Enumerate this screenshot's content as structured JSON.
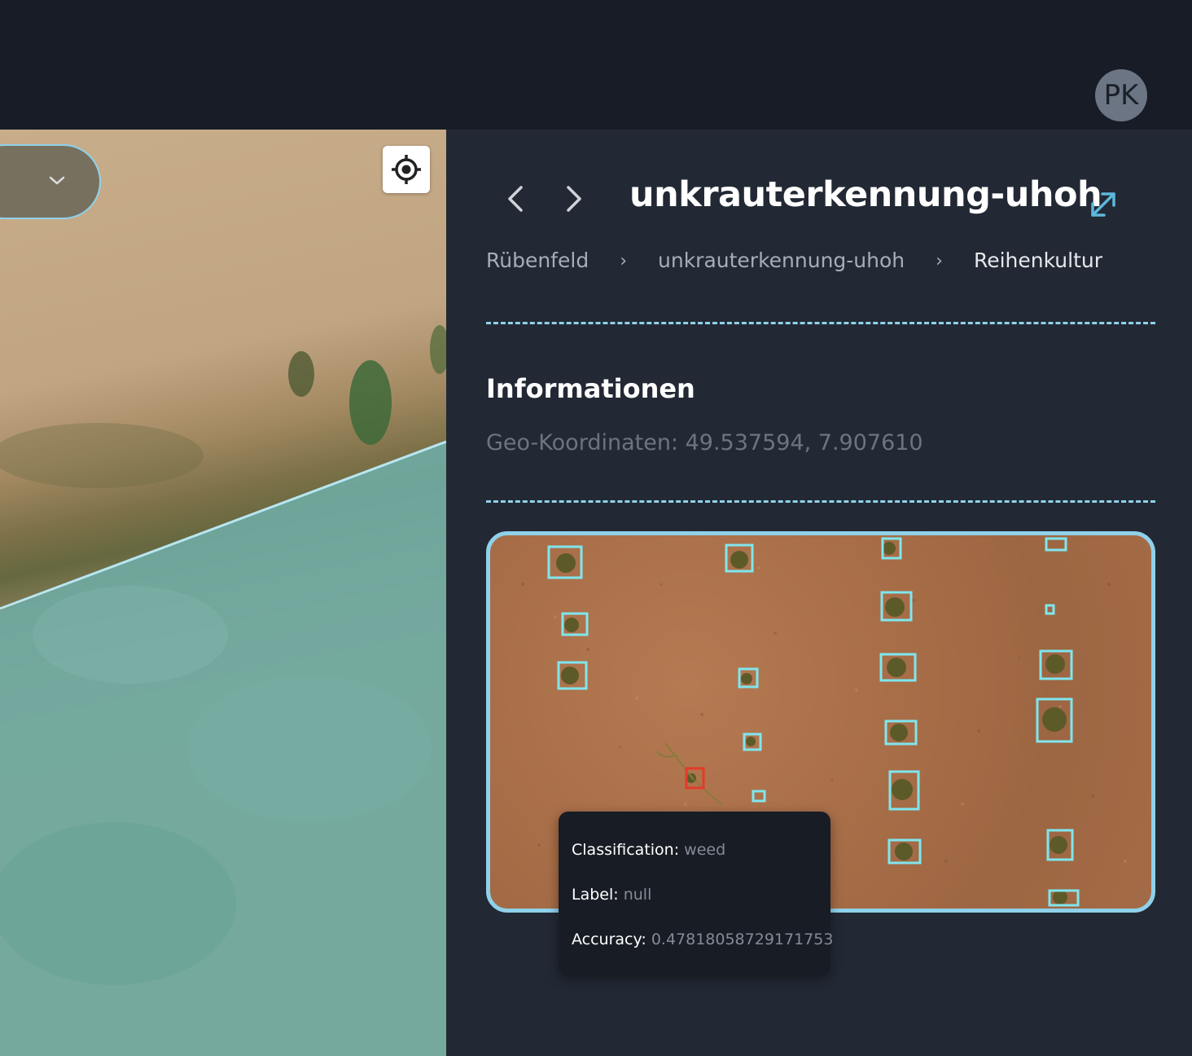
{
  "header": {
    "avatar_initials": "PK"
  },
  "map": {
    "dropdown_icon": "chevron-down-icon",
    "locate_icon": "crosshair-icon",
    "field_overlay_color": "#6fa9a0",
    "field_border_color": "#b8e6f2"
  },
  "panel": {
    "title": "unkrauterkennung-uhoh",
    "breadcrumb": [
      "Rübenfeld",
      "unkrauterkennung-uhoh",
      "Reihenkultur"
    ],
    "breadcrumb_separator": "›",
    "section_title": "Informationen",
    "geo_label": "Geo-Koordinaten: 49.537594, 7.907610",
    "accent_color": "#8fd1ea"
  },
  "detection_image": {
    "box_color_crop": "#7fe6ee",
    "box_color_weed": "#e23b2a"
  },
  "tooltip": {
    "classification_label": "Classification:",
    "classification_value": "weed",
    "label_label": "Label:",
    "label_value": "null",
    "accuracy_label": "Accuracy:",
    "accuracy_value": "0.47818058729171753"
  }
}
